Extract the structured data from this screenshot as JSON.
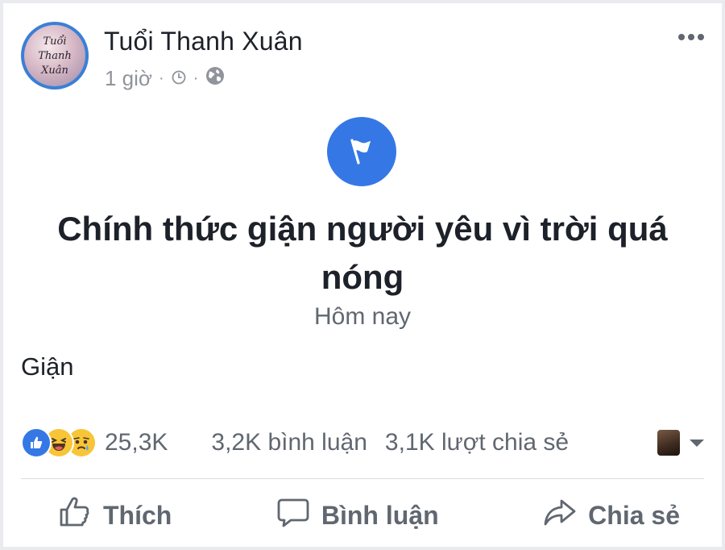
{
  "post": {
    "page_name": "Tuổi Thanh Xuân",
    "time": "1 giờ",
    "separator": "·",
    "avatar_text": [
      "Tuổi",
      "Thanh",
      "Xuân"
    ],
    "body_text": "Giận"
  },
  "event": {
    "title": "Chính thức giận người yêu vì trời quá nóng",
    "date": "Hôm nay"
  },
  "stats": {
    "reactions": [
      "like-icon",
      "haha-icon",
      "sad-icon"
    ],
    "reaction_count": "25,3K",
    "comments": "3,2K bình luận",
    "shares": "3,1K lượt chia sẻ"
  },
  "actions": {
    "like": "Thích",
    "comment": "Bình luận",
    "share": "Chia sẻ"
  },
  "colors": {
    "accent": "#3578e5",
    "text": "#1d2129",
    "muted": "#606770"
  }
}
